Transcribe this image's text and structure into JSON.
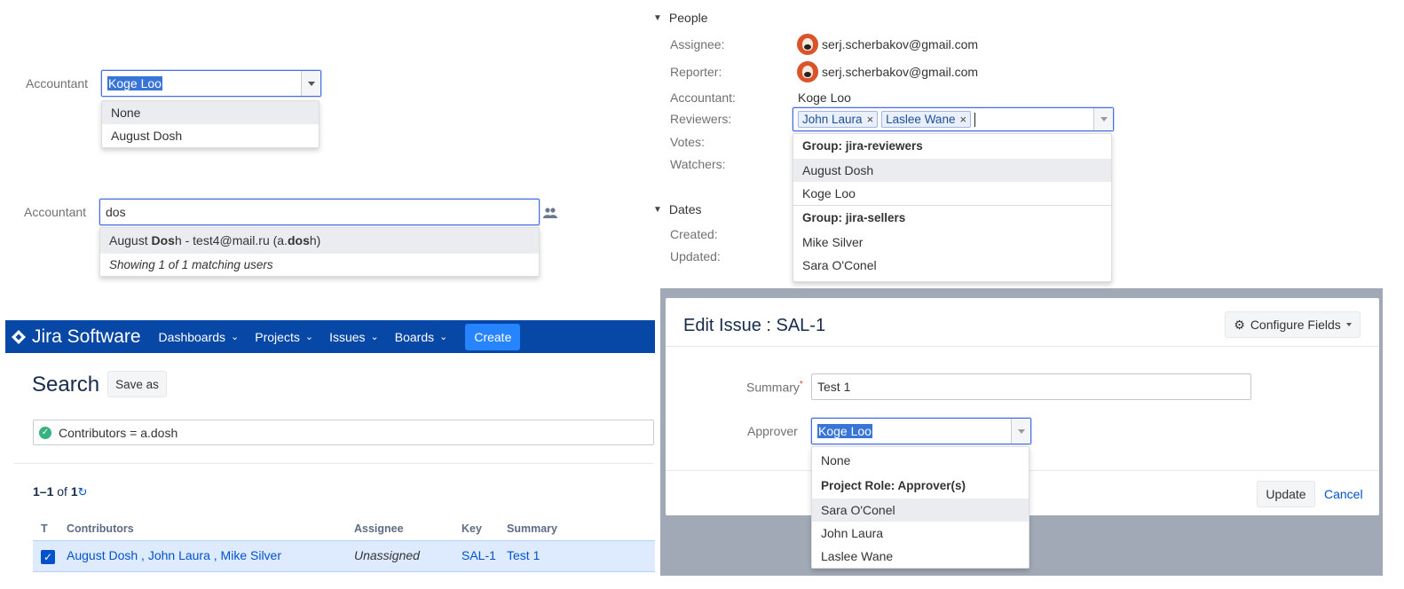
{
  "accountant_select": {
    "label": "Accountant",
    "value": "Koge Loo",
    "options": [
      "None",
      "August Dosh"
    ]
  },
  "accountant_search": {
    "label": "Accountant",
    "value": "dos",
    "suggestion_pre": "August ",
    "suggestion_bold1": "Dos",
    "suggestion_mid": "h - test4@mail.ru (a.",
    "suggestion_bold2": "dos",
    "suggestion_post": "h)",
    "footer": "Showing 1 of 1 matching users"
  },
  "people": {
    "title": "People",
    "assignee_label": "Assignee:",
    "assignee_value": "serj.scherbakov@gmail.com",
    "reporter_label": "Reporter:",
    "reporter_value": "serj.scherbakov@gmail.com",
    "accountant_label": "Accountant:",
    "accountant_value": "Koge Loo",
    "reviewers_label": "Reviewers:",
    "reviewers_chips": [
      "John Laura",
      "Laslee Wane"
    ],
    "votes_label": "Votes:",
    "watchers_label": "Watchers:",
    "dropdown": {
      "group1": "Group: jira-reviewers",
      "group1_items": [
        "August Dosh",
        "Koge Loo"
      ],
      "group2": "Group: jira-sellers",
      "group2_items": [
        "Mike Silver",
        "Sara O'Conel"
      ]
    }
  },
  "dates": {
    "title": "Dates",
    "created_label": "Created:",
    "updated_label": "Updated:"
  },
  "jira": {
    "logo_text": "Jira Software",
    "nav": [
      "Dashboards",
      "Projects",
      "Issues",
      "Boards"
    ],
    "create_label": "Create",
    "search_title": "Search",
    "save_as_label": "Save as",
    "query": "Contributors = a.dosh",
    "results_range": "1–1",
    "results_of": "of",
    "results_total": "1",
    "columns": [
      "T",
      "Contributors",
      "Assignee",
      "Key",
      "Summary"
    ],
    "row": {
      "contributors": "August Dosh , John Laura , Mike Silver",
      "assignee": "Unassigned",
      "key": "SAL-1",
      "summary": "Test 1"
    }
  },
  "edit_issue": {
    "title": "Edit Issue : SAL-1",
    "configure_label": "Configure Fields",
    "summary_label": "Summary",
    "required_mark": "*",
    "summary_value": "Test 1",
    "approver_label": "Approver",
    "approver_value": "Koge Loo",
    "options_none": "None",
    "group_label": "Project Role: Approver(s)",
    "group_items": [
      "Sara O'Conel",
      "John Laura",
      "Laslee Wane"
    ],
    "update_label": "Update",
    "cancel_label": "Cancel"
  },
  "colors": {
    "jira_blue": "#0747a6",
    "create_blue": "#2684ff",
    "selection_highlight": "#3875d7",
    "row_selected": "#deebff"
  }
}
